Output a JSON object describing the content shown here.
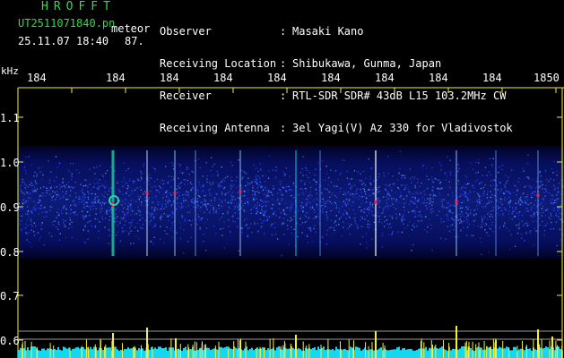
{
  "header": {
    "title": "HROFFT",
    "filename": "UT2511071840.pn",
    "label": "meteor",
    "datetime": "25.11.07 18:40",
    "count": "87."
  },
  "info": [
    {
      "key": "Observer",
      "sep": ":",
      "value": "Masaki Kano"
    },
    {
      "key": "Receiving Location",
      "sep": ":",
      "value": "Shibukawa, Gunma, Japan"
    },
    {
      "key": "Receiver",
      "sep": ":",
      "value": "RTL-SDR SDR# 43dB L15 103.2MHz CW"
    },
    {
      "key": "Receiving Antenna",
      "sep": ":",
      "value": "3el Yagi(V) Az 330 for Vladivostok"
    }
  ],
  "axis": {
    "y_unit": "kHz",
    "y_ticks": [
      "1.1",
      "1.0",
      "0.9",
      "0.8",
      "0.7",
      "0.6"
    ],
    "x_ticks": [
      "184",
      "184",
      "184",
      "184",
      "184",
      "184",
      "184",
      "184",
      "184",
      "1850"
    ]
  },
  "colors": {
    "background": "#000000",
    "header_green": "#2fdc4a",
    "axis_yellow": "#f2f03a",
    "echo_red": "#ff2040",
    "noise_blue": "#1a2ad8",
    "trace_cyan": "#14d8f0"
  }
}
